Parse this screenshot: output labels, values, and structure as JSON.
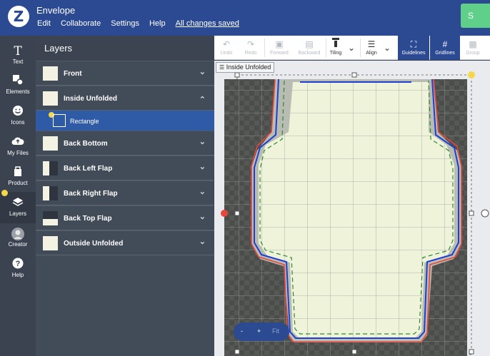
{
  "app": {
    "logo": "Z",
    "title": "Envelope",
    "save_label": "S"
  },
  "menu": {
    "edit": "Edit",
    "collaborate": "Collaborate",
    "settings": "Settings",
    "help": "Help",
    "saved": "All changes saved"
  },
  "rail": [
    {
      "label": "Text",
      "icon": "T"
    },
    {
      "label": "Elements",
      "icon": "elements-icon"
    },
    {
      "label": "Icons",
      "icon": "smiley-icon"
    },
    {
      "label": "My Files",
      "icon": "cloud-upload-icon"
    },
    {
      "label": "Product",
      "icon": "product-icon"
    },
    {
      "label": "Layers",
      "icon": "layers-icon"
    },
    {
      "label": "Creator",
      "icon": "avatar"
    },
    {
      "label": "Help",
      "icon": "?"
    }
  ],
  "layers": {
    "title": "Layers",
    "items": [
      {
        "label": "Front",
        "expanded": false
      },
      {
        "label": "Inside Unfolded",
        "expanded": true
      },
      {
        "label": "Back Bottom",
        "expanded": false
      },
      {
        "label": "Back Left Flap",
        "expanded": false
      },
      {
        "label": "Back Right Flap",
        "expanded": false
      },
      {
        "label": "Back Top Flap",
        "expanded": false
      },
      {
        "label": "Outside Unfolded",
        "expanded": false
      }
    ],
    "sub_item": "Rectangle"
  },
  "toolbar": {
    "undo": "Undo",
    "redo": "Redo",
    "forward": "Forward",
    "backward": "Backward",
    "tiling": "Tiling",
    "align": "Align",
    "guidelines": "Guidelines",
    "gridlines": "Gridlines",
    "group": "Group"
  },
  "canvas": {
    "selected_tag": "Inside Unfolded"
  },
  "zoom": {
    "minus": "-",
    "plus": "+",
    "fit": "Fit"
  },
  "colors": {
    "brand": "#2b4a91",
    "accent": "#5fcf8a",
    "highlight": "#f5d84a",
    "cut": "#e8473e",
    "bleed": "#1f3fd1",
    "safe": "#2e8a2e",
    "paper": "#eff3da"
  }
}
